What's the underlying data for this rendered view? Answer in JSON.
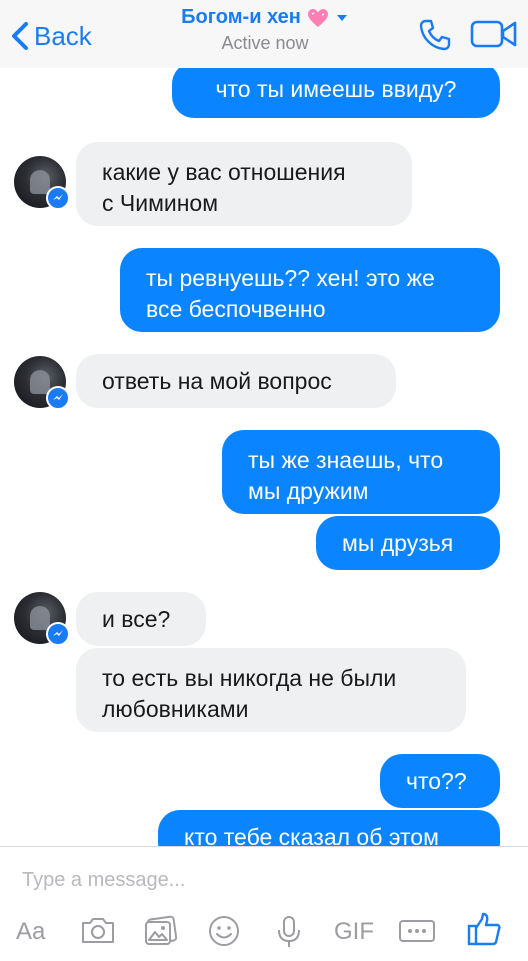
{
  "header": {
    "back_label": "Back",
    "contact_name": "Богом-и хен",
    "status": "Active now"
  },
  "messages": [
    {
      "direction": "outgoing",
      "text": "что ты имеешь ввиду?"
    },
    {
      "direction": "incoming",
      "text": "какие у вас отношения\nс Чимином"
    },
    {
      "direction": "outgoing",
      "text": "ты ревнуешь?? хен! это же\nвсе беспочвенно"
    },
    {
      "direction": "incoming",
      "text": "ответь на мой вопрос"
    },
    {
      "direction": "outgoing",
      "text": "ты же знаешь, что\nмы дружим"
    },
    {
      "direction": "outgoing",
      "text": "мы друзья"
    },
    {
      "direction": "incoming",
      "text": "и все?"
    },
    {
      "direction": "incoming",
      "text": "то есть вы никогда не были\nлюбовниками"
    },
    {
      "direction": "outgoing",
      "text": "что??"
    },
    {
      "direction": "outgoing",
      "text": "кто тебе сказал об этом"
    }
  ],
  "composer": {
    "placeholder": "Type a message...",
    "text_tool_label": "Aa",
    "gif_label": "GIF"
  },
  "colors": {
    "accent": "#1a7cf5",
    "outgoing_bubble": "#0a84ff",
    "incoming_bubble": "#eef0f2"
  },
  "icons": [
    "chevron-left-icon",
    "heart-icon",
    "chevron-down-icon",
    "phone-icon",
    "video-camera-icon",
    "messenger-badge-icon",
    "camera-icon",
    "gallery-icon",
    "emoji-icon",
    "microphone-icon",
    "more-icon",
    "thumbs-up-icon"
  ]
}
